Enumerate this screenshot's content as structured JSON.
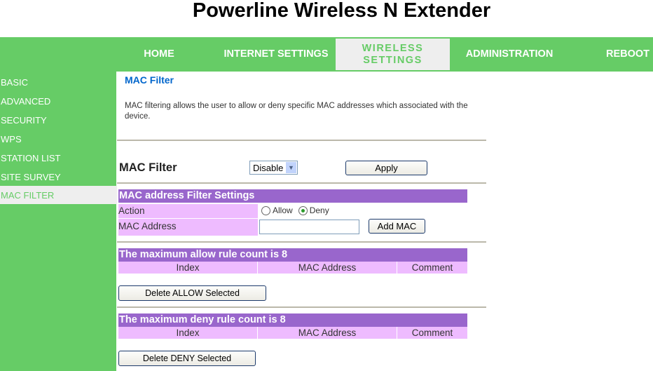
{
  "header": {
    "title": "Powerline Wireless N Extender"
  },
  "nav": [
    {
      "label": "HOME"
    },
    {
      "label": "INTERNET SETTINGS"
    },
    {
      "label": "WIRELESS SETTINGS",
      "active": true
    },
    {
      "label": "ADMINISTRATION"
    },
    {
      "label": "REBOOT"
    }
  ],
  "sidebar": [
    {
      "label": "BASIC"
    },
    {
      "label": "ADVANCED"
    },
    {
      "label": "SECURITY"
    },
    {
      "label": "WPS"
    },
    {
      "label": "STATION LIST"
    },
    {
      "label": "SITE SURVEY"
    },
    {
      "label": "MAC FILTER",
      "active": true
    }
  ],
  "main": {
    "heading": "MAC Filter",
    "description": "MAC filtering allows the user to allow or deny specific MAC addresses which associated with the device.",
    "filter_label": "MAC Filter",
    "filter_value": "Disable",
    "apply": "Apply",
    "settings_title": "MAC address Filter Settings",
    "action_label": "Action",
    "allow": "Allow",
    "deny": "Deny",
    "selected_action": "Deny",
    "mac_label": "MAC Address",
    "mac_value": "",
    "add_mac": "Add MAC",
    "allow_title": "The maximum allow rule count is 8",
    "deny_title": "The maximum deny rule count is 8",
    "columns": [
      "Index",
      "MAC Address",
      "Comment"
    ],
    "delete_allow": "Delete ALLOW Selected",
    "delete_deny": "Delete DENY Selected"
  },
  "colors": {
    "green": "#66cc66",
    "purple": "#9966cc",
    "pink": "#eebbff",
    "link": "#0066cc"
  }
}
